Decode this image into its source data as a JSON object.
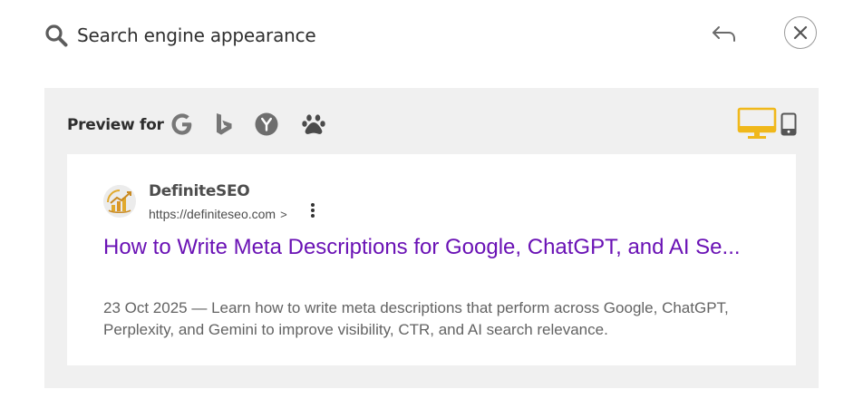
{
  "header": {
    "title": "Search engine appearance",
    "search_icon": "search-icon",
    "back_icon": "undo-arrow-icon",
    "close_icon": "close-icon"
  },
  "preview": {
    "label": "Preview for",
    "engines": [
      "google-icon",
      "bing-icon",
      "yahoo-icon",
      "baidu-paw-icon"
    ],
    "devices": {
      "desktop": {
        "icon": "desktop-icon",
        "active": true
      },
      "mobile": {
        "icon": "mobile-icon",
        "active": false
      }
    }
  },
  "result": {
    "site_name": "DefiniteSEO",
    "url": "https://definiteseo.com",
    "url_separator": ">",
    "title": "How to Write Meta Descriptions for Google, ChatGPT, and AI Se...",
    "description": "23 Oct 2025 — Learn how to write meta descriptions that perform across Google, ChatGPT, Perplexity, and Gemini to improve visibility, CTR, and AI search relevance."
  },
  "colors": {
    "active_device": "#f0b81b",
    "inactive_icon": "#666666",
    "title_link": "#6a12b5",
    "panel_bg": "#f0f0f0"
  }
}
